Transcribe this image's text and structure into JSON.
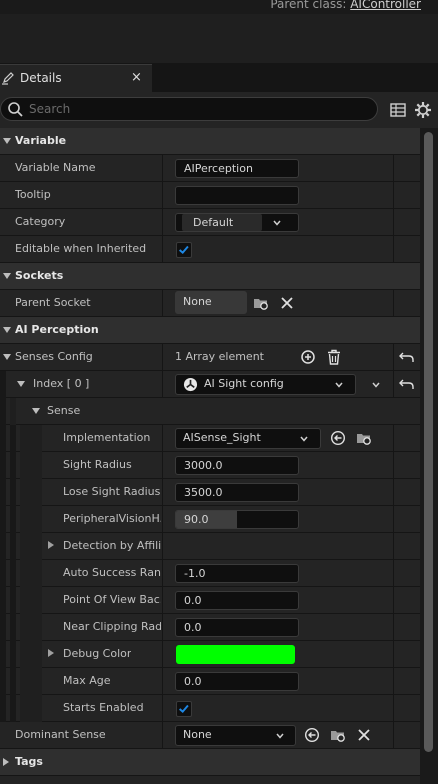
{
  "header": {
    "parent_class_label": "Parent class:",
    "parent_class_value": "AIController"
  },
  "tab": {
    "label": "Details",
    "close": "×"
  },
  "search": {
    "placeholder": "Search"
  },
  "colors": {
    "accent": "#1565c0",
    "debug_color": "#00ff00",
    "panel_bg": "#242424"
  },
  "rows": {
    "variable_cat": "Variable",
    "variable_name": {
      "label": "Variable Name",
      "value": "AIPerception"
    },
    "tooltip": {
      "label": "Tooltip",
      "value": ""
    },
    "category": {
      "label": "Category",
      "value": "Default"
    },
    "editable": {
      "label": "Editable when Inherited",
      "checked": true
    },
    "sockets_cat": "Sockets",
    "parent_socket": {
      "label": "Parent Socket",
      "value": "None"
    },
    "ai_perception_cat": "AI Perception",
    "senses_config": {
      "label": "Senses Config",
      "value": "1 Array element"
    },
    "index": {
      "label": "Index [ 0 ]",
      "value": "AI Sight config"
    },
    "sense": {
      "label": "Sense"
    },
    "implementation": {
      "label": "Implementation",
      "value": "AISense_Sight"
    },
    "sight_radius": {
      "label": "Sight Radius",
      "value": "3000.0"
    },
    "lose_sight_radius": {
      "label": "Lose Sight Radius",
      "value": "3500.0"
    },
    "peripheral": {
      "label": "PeripheralVisionH...",
      "value": "90.0",
      "fraction": 0.5
    },
    "detection": {
      "label": "Detection by Affili..."
    },
    "auto_success": {
      "label": "Auto Success Ran...",
      "value": "-1.0"
    },
    "pov_back": {
      "label": "Point Of View Bac...",
      "value": "0.0"
    },
    "near_clip": {
      "label": "Near Clipping Radi...",
      "value": "0.0"
    },
    "debug_color": {
      "label": "Debug Color"
    },
    "max_age": {
      "label": "Max Age",
      "value": "0.0"
    },
    "starts_enabled": {
      "label": "Starts Enabled",
      "checked": true
    },
    "dominant_sense": {
      "label": "Dominant Sense",
      "value": "None"
    },
    "tags_cat": "Tags"
  }
}
